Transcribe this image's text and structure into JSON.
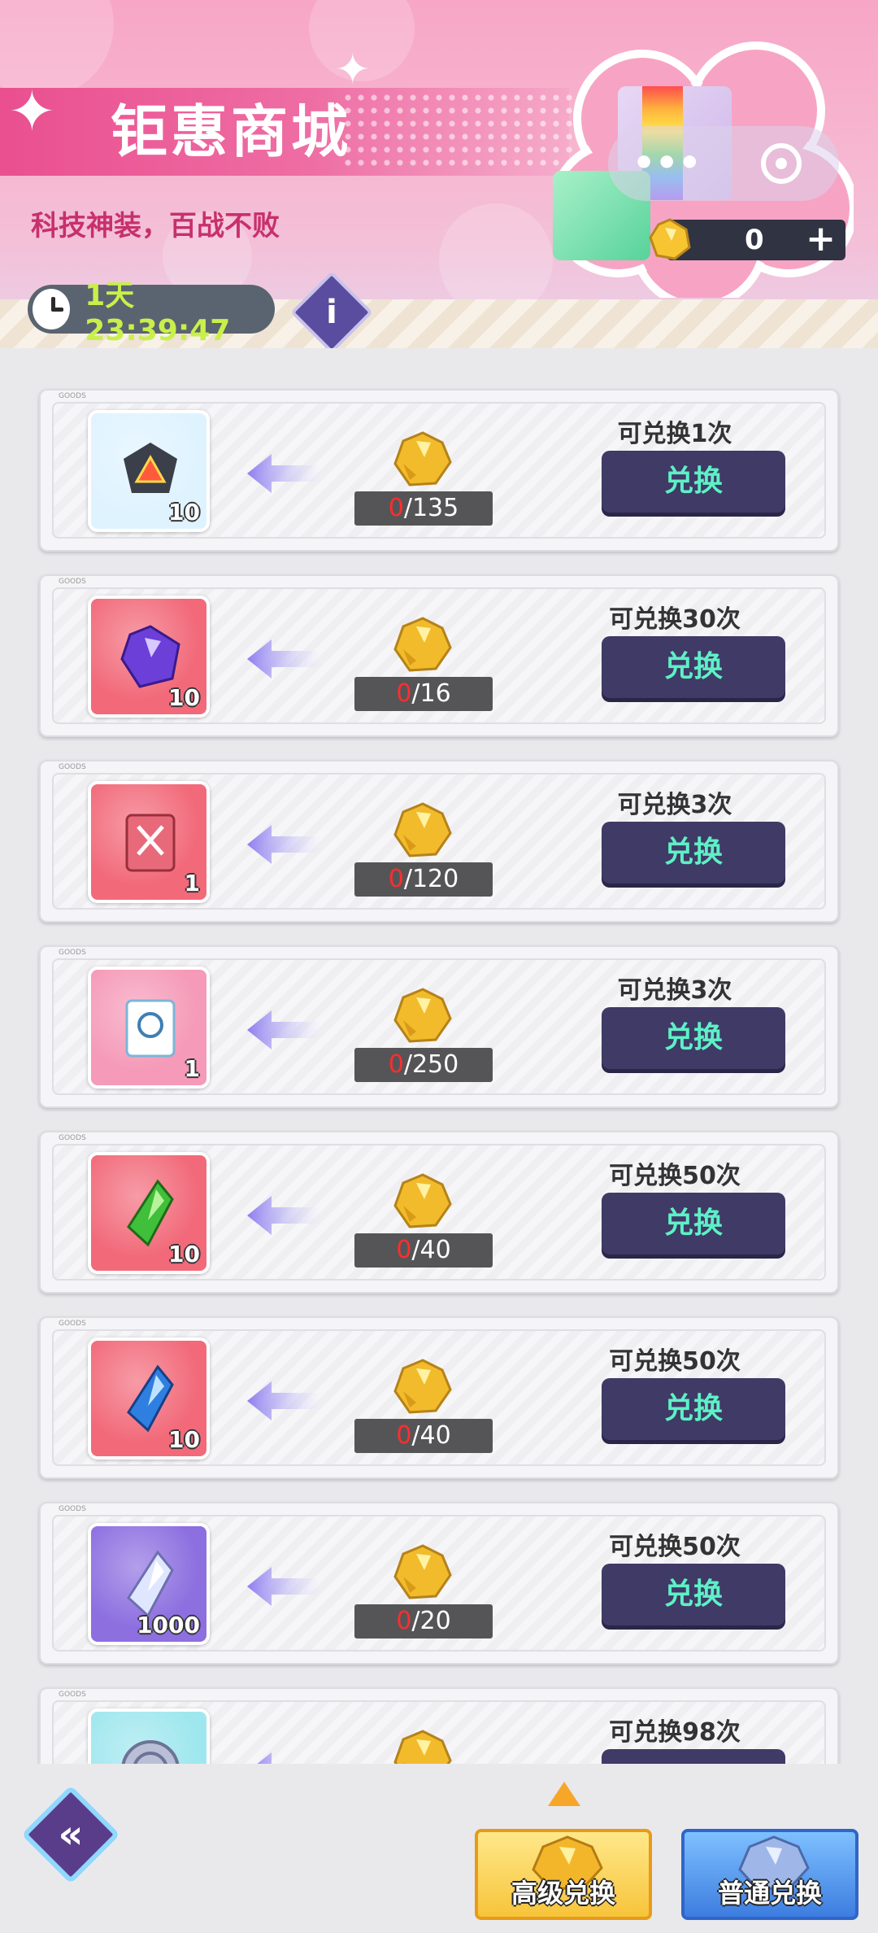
{
  "header": {
    "title": "钜惠商城",
    "subtitle": "科技神装，百战不败",
    "timer": "1天 23:39:47",
    "info_icon": "i",
    "more_icon": "•••",
    "currency_amount": "0",
    "currency_plus": "+"
  },
  "goods_tag": "GOODS",
  "items": [
    {
      "qty": "10",
      "have": "0",
      "cost": "/135",
      "limit": "可兑换1次",
      "button": "兑换",
      "icon": "tech-part-icon",
      "bg": "#dff3ff"
    },
    {
      "qty": "10",
      "have": "0",
      "cost": "/16",
      "limit": "可兑换30次",
      "button": "兑换",
      "icon": "purple-crystal-icon",
      "bg": "#f26a7a"
    },
    {
      "qty": "1",
      "have": "0",
      "cost": "/120",
      "limit": "可兑换3次",
      "button": "兑换",
      "icon": "weapon-ticket-icon",
      "bg": "#f26a7a"
    },
    {
      "qty": "1",
      "have": "0",
      "cost": "/250",
      "limit": "可兑换3次",
      "button": "兑换",
      "icon": "chip-ticket-icon",
      "bg": "#f59ab8"
    },
    {
      "qty": "10",
      "have": "0",
      "cost": "/40",
      "limit": "可兑换50次",
      "button": "兑换",
      "icon": "green-crystal-icon",
      "bg": "#f26a7a"
    },
    {
      "qty": "10",
      "have": "0",
      "cost": "/40",
      "limit": "可兑换50次",
      "button": "兑换",
      "icon": "blue-crystal-icon",
      "bg": "#f26a7a"
    },
    {
      "qty": "1000",
      "have": "0",
      "cost": "/20",
      "limit": "可兑换50次",
      "button": "兑换",
      "icon": "white-crystal-icon",
      "bg": "#8d6fe0"
    },
    {
      "qty": "",
      "have": "",
      "cost": "",
      "limit": "可兑换98次",
      "button": "",
      "icon": "coin-icon",
      "bg": "#9fe7ee"
    }
  ],
  "bottom": {
    "back_icon": "«",
    "tab_advanced": "高级兑换",
    "tab_normal": "普通兑换"
  },
  "colors": {
    "accent_pink": "#ea4f8f",
    "button_bg": "#3f3a66",
    "button_text": "#5ef0c6",
    "have_red": "#ff2d2d"
  }
}
